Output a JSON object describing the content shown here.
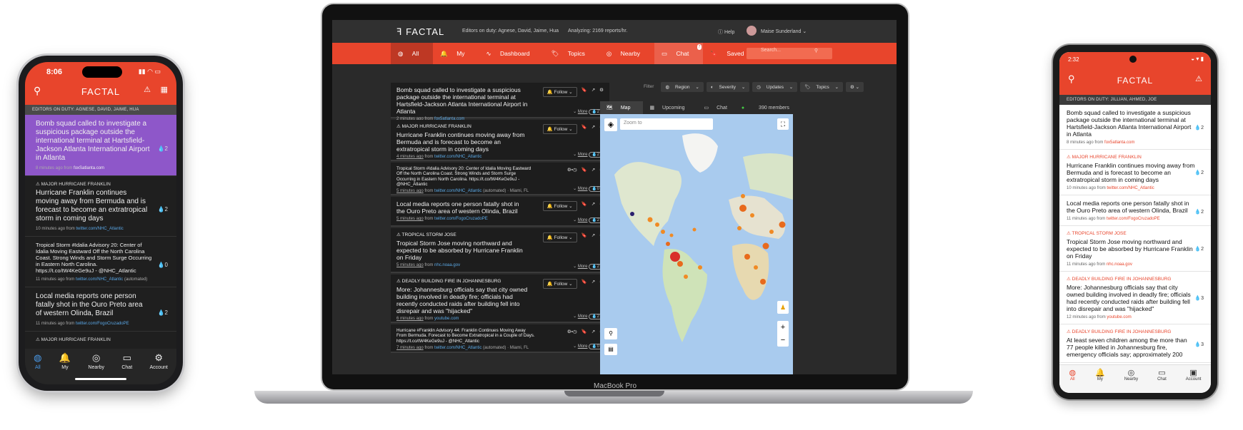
{
  "brand": "FACTAL",
  "iphone": {
    "time": "8:06",
    "editors": "EDITORS ON DUTY: AGNESE, DAVID, JAIME, HUA",
    "items": [
      {
        "tag": "",
        "headline": "Bomb squad called to investigate a suspicious package outside the international terminal at Hartsfield-Jackson Atlanta International Airport in Atlanta",
        "time": "8 minutes ago from",
        "source": "foxSatlanta.com",
        "count": "2"
      },
      {
        "tag": "MAJOR HURRICANE FRANKLIN",
        "headline": "Hurricane Franklin continues moving away from Bermuda and is forecast to become an extratropical storm in coming days",
        "time": "10 minutes ago from",
        "source": "twitter.com/NHC_Atlantic",
        "count": "2"
      },
      {
        "tag": "",
        "headline": "Tropical Storm #Idalia Advisory 20: Center of Idalia Moving Eastward Off the North Carolina Coast. Strong Winds and Storm Surge Occurring in Eastern North Carolina. https://t.co/tW4KeGe9uJ - @NHC_Atlantic",
        "time": "11 minutes ago from",
        "source": "twitter.com/NHC_Atlantic",
        "extra": "(automated)",
        "count": "0"
      },
      {
        "tag": "",
        "headline": "Local media reports one person fatally shot in the Ouro Preto area of western Olinda, Brazil",
        "time": "11 minutes ago from",
        "source": "twitter.com/FogoCruzadoPE",
        "count": "2"
      },
      {
        "tag": "MAJOR HURRICANE FRANKLIN",
        "headline": "",
        "time": "",
        "source": "",
        "count": ""
      }
    ],
    "nav": [
      "All",
      "My",
      "Nearby",
      "Chat",
      "Account"
    ]
  },
  "laptop": {
    "editors": "Editors on duty: Agnese, David, Jaime, Hua",
    "analyzing": "Analyzing: 2169 reports/hr.",
    "help": "Help",
    "user": "Maise Sunderland",
    "nav": [
      "All",
      "My",
      "Dashboard",
      "Topics",
      "Nearby",
      "Chat",
      "Saved"
    ],
    "search": "Search...",
    "chat_badge": "7",
    "filters": [
      "Filter",
      "Region",
      "Severity",
      "Updates",
      "Topics"
    ],
    "tabs": [
      "Map",
      "Upcoming",
      "Chat",
      "390 members"
    ],
    "zoom": "Zoom to",
    "model": "MacBook Pro",
    "follow": "Follow",
    "more": "More",
    "cards": [
      {
        "tag": "",
        "headline": "Bomb squad called to investigate a suspicious package outside the international terminal at Hartsfield-Jackson Atlanta International Airport in Atlanta",
        "time": "2 minutes ago",
        "from": "from",
        "source": "fox5atlanta.com",
        "count": "2"
      },
      {
        "tag": "MAJOR HURRICANE FRANKLIN",
        "headline": "Hurricane Franklin continues moving away from Bermuda and is forecast to become an extratropical storm in coming days",
        "time": "4 minutes ago",
        "from": "from",
        "source": "twitter.com/NHC_Atlantic",
        "count": "2"
      },
      {
        "tag": "",
        "headline": "Tropical Storm #Idalia Advisory 20: Center of Idalia Moving Eastward Off the North Carolina Coast. Strong Winds and Storm Surge Occurring in Eastern North Carolina. https://t.co/tW4KeGe9uJ - @NHC_Atlantic",
        "time": "5 minutes ago",
        "from": "from",
        "source": "twitter.com/NHC_Atlantic",
        "extra": "(automated) · Miami, FL",
        "count": "0"
      },
      {
        "tag": "",
        "headline": "Local media reports one person fatally shot in the Ouro Preto area of western Olinda, Brazil",
        "time": "5 minutes ago",
        "from": "from",
        "source": "twitter.com/FogoCruzadoPE",
        "count": "2"
      },
      {
        "tag": "TROPICAL STORM JOSE",
        "headline": "Tropical Storm Jose moving northward and expected to be absorbed by Hurricane Franklin on Friday",
        "time": "5 minutes ago",
        "from": "from",
        "source": "nhc.noaa.gov",
        "count": "2"
      },
      {
        "tag": "DEADLY BUILDING FIRE IN JOHANNESBURG",
        "headline": "More: Johannesburg officials say that city owned building involved in deadly fire; officials had recently conducted raids after building fell into disrepair and was \"hijacked\"",
        "time": "6 minutes ago",
        "from": "from",
        "source": "youtube.com",
        "count": "2"
      },
      {
        "tag": "",
        "headline": "Hurricane #Franklin Advisory 44: Franklin Continues Moving Away From Bermuda. Forecast to Become Extratropical in a Couple of Days. https://t.co/tW4KeGe9uJ - @NHC_Atlantic",
        "time": "7 minutes ago",
        "from": "from",
        "source": "twitter.com/NHC_Atlantic",
        "extra": "(automated) · Miami, FL",
        "count": "0"
      }
    ]
  },
  "android": {
    "time": "2:32",
    "editors": "EDITORS ON DUTY: JILLIAN, AHMED, JOE",
    "items": [
      {
        "tag": "",
        "headline": "Bomb squad called to investigate a suspicious package outside the international terminal at Hartsfield-Jackson Atlanta International Airport in Atlanta",
        "time": "8 minutes ago from",
        "source": "fox5atlanta.com",
        "count": "2"
      },
      {
        "tag": "MAJOR HURRICANE FRANKLIN",
        "headline": "Hurricane Franklin continues moving away from Bermuda and is forecast to become an extratropical storm in coming days",
        "time": "10 minutes ago from",
        "source": "twitter.com/NHC_Atlantic",
        "count": "2"
      },
      {
        "tag": "",
        "headline": "Local media reports one person fatally shot in the Ouro Preto area of western Olinda, Brazil",
        "time": "11 minutes ago from",
        "source": "twitter.com/FogoCruzadoPE",
        "count": "2"
      },
      {
        "tag": "TROPICAL STORM JOSE",
        "headline": "Tropical Storm Jose moving northward and expected to be absorbed by Hurricane Franklin on Friday",
        "time": "11 minutes ago from",
        "source": "nhc.noaa.gov",
        "count": "2"
      },
      {
        "tag": "DEADLY BUILDING FIRE IN JOHANNESBURG",
        "headline": "More: Johannesburg officials say that city owned building involved in deadly fire; officials had recently conducted raids after building fell into disrepair and was \"hijacked\"",
        "time": "12 minutes ago from",
        "source": "youtube.com",
        "count": "3"
      },
      {
        "tag": "DEADLY BUILDING FIRE IN JOHANNESBURG",
        "headline": "At least seven children among the more than 77 people killed in Johannesburg fire, emergency officials say; approximately 200",
        "time": "",
        "source": "",
        "count": "3"
      }
    ],
    "nav": [
      "All",
      "My",
      "Nearby",
      "Chat",
      "Account"
    ]
  }
}
